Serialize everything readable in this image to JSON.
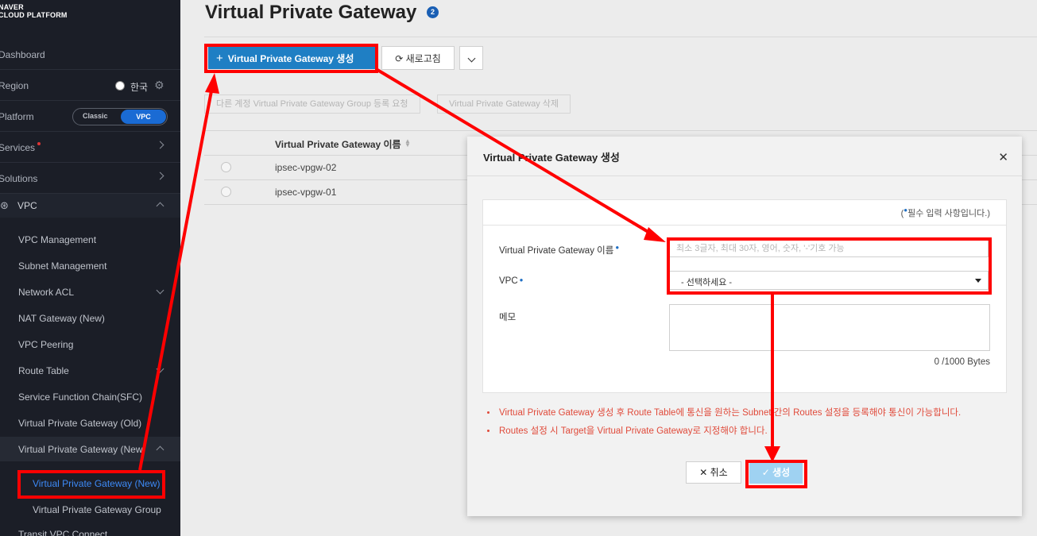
{
  "brand": {
    "line1": "NAVER",
    "line2": "CLOUD PLATFORM"
  },
  "sidebar": {
    "dashboard": "Dashboard",
    "region_label": "Region",
    "region_value": "한국",
    "platform_label": "Platform",
    "platform_classic": "Classic",
    "platform_vpc": "VPC",
    "services": "Services",
    "solutions": "Solutions",
    "vpc": "VPC",
    "items": [
      "VPC Management",
      "Subnet Management",
      "Network ACL",
      "NAT Gateway (New)",
      "VPC Peering",
      "Route Table",
      "Service Function Chain(SFC)",
      "Virtual Private Gateway (Old)",
      "Virtual Private Gateway (New"
    ],
    "subitems": [
      "Virtual Private Gateway (New)",
      "Virtual Private Gateway Group"
    ],
    "cut_item": "Transit VPC Connect"
  },
  "page": {
    "title": "Virtual Private Gateway",
    "count": "2"
  },
  "toolbar": {
    "create": "Virtual Private Gateway 생성",
    "refresh": "새로고침",
    "request_group": "다른 계정 Virtual Private Gateway Group 등록 요청",
    "delete": "Virtual Private Gateway 삭제"
  },
  "table": {
    "column": "Virtual Private Gateway 이름",
    "rows": [
      "ipsec-vpgw-02",
      "ipsec-vpgw-01"
    ]
  },
  "modal": {
    "title": "Virtual Private Gateway 생성",
    "required_note_pre": "(",
    "required_note": "필수 입력 사항입니다.)",
    "name_label": "Virtual Private Gateway 이름",
    "name_placeholder": "최소 3글자, 최대 30자, 영어, 숫자, '-'기호 가능",
    "vpc_label": "VPC",
    "vpc_value": "- 선택하세요 -",
    "memo_label": "메모",
    "bytes": "0 /1000 Bytes",
    "warnings": [
      "Virtual Private Gateway 생성 후 Route Table에 통신을 원하는 Subnet 간의 Routes 설정을 등록해야 통신이 가능합니다.",
      "Routes 설정 시 Target을 Virtual Private Gateway로 지정해야 합니다."
    ],
    "cancel": "취소",
    "create": "생성"
  },
  "colors": {
    "annotation": "#ff0000",
    "primary": "#1f7fc4",
    "sidebar_bg": "#1b1e27"
  }
}
